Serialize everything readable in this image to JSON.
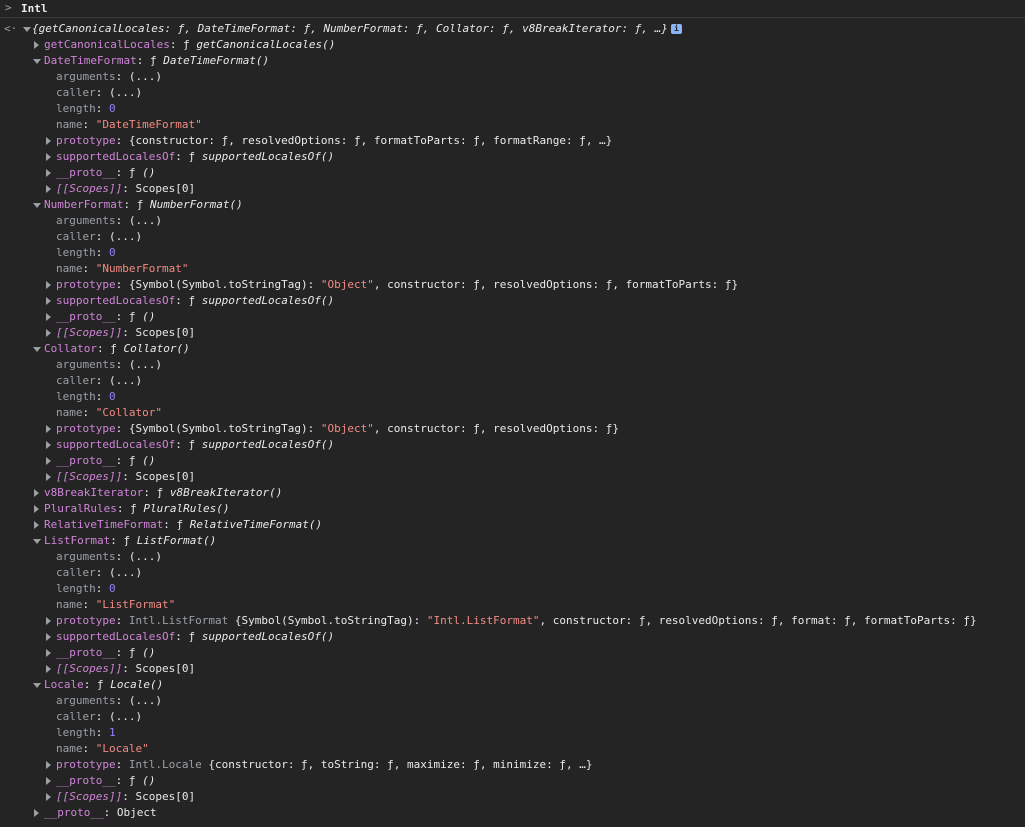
{
  "input": {
    "prompt_icon": "chevron-right-icon",
    "expression": "Intl"
  },
  "result": {
    "arrow_icon": "return-arrow-icon",
    "summary_keys": [
      "getCanonicalLocales",
      "DateTimeFormat",
      "NumberFormat",
      "Collator",
      "v8BreakIterator"
    ],
    "fn_symbol": "ƒ",
    "ellipsis": "…",
    "info_icon": "info-icon"
  },
  "rows": [
    {
      "indent": 1,
      "toggle": "collapsed",
      "key": "getCanonicalLocales",
      "kind": "fn",
      "fn_name": "getCanonicalLocales()"
    },
    {
      "indent": 1,
      "toggle": "expanded",
      "key": "DateTimeFormat",
      "kind": "fn",
      "fn_name": "DateTimeFormat()"
    },
    {
      "indent": 2,
      "toggle": "none",
      "key": "arguments",
      "kind": "plain",
      "text": "(...)"
    },
    {
      "indent": 2,
      "toggle": "none",
      "key": "caller",
      "kind": "plain",
      "text": "(...)"
    },
    {
      "indent": 2,
      "toggle": "none",
      "key": "length",
      "kind": "num",
      "text": "0"
    },
    {
      "indent": 2,
      "toggle": "none",
      "key": "name",
      "kind": "str",
      "text": "\"DateTimeFormat\""
    },
    {
      "indent": 2,
      "toggle": "collapsed",
      "key": "prototype",
      "kind": "obj",
      "text": "{constructor: ƒ, resolvedOptions: ƒ, formatToParts: ƒ, formatRange: ƒ, …}"
    },
    {
      "indent": 2,
      "toggle": "collapsed",
      "key": "supportedLocalesOf",
      "kind": "fn",
      "fn_name": "supportedLocalesOf()"
    },
    {
      "indent": 2,
      "toggle": "collapsed",
      "key": "__proto__",
      "kind": "fn",
      "fn_name": "()"
    },
    {
      "indent": 2,
      "toggle": "collapsed",
      "key": "[[Scopes]]",
      "kind": "scopes",
      "text": "Scopes[0]"
    },
    {
      "indent": 1,
      "toggle": "expanded",
      "key": "NumberFormat",
      "kind": "fn",
      "fn_name": "NumberFormat()"
    },
    {
      "indent": 2,
      "toggle": "none",
      "key": "arguments",
      "kind": "plain",
      "text": "(...)"
    },
    {
      "indent": 2,
      "toggle": "none",
      "key": "caller",
      "kind": "plain",
      "text": "(...)"
    },
    {
      "indent": 2,
      "toggle": "none",
      "key": "length",
      "kind": "num",
      "text": "0"
    },
    {
      "indent": 2,
      "toggle": "none",
      "key": "name",
      "kind": "str",
      "text": "\"NumberFormat\""
    },
    {
      "indent": 2,
      "toggle": "collapsed",
      "key": "prototype",
      "kind": "objstr",
      "pre": "{Symbol(Symbol.toStringTag): ",
      "strval": "\"Object\"",
      "post": ", constructor: ƒ, resolvedOptions: ƒ, formatToParts: ƒ}"
    },
    {
      "indent": 2,
      "toggle": "collapsed",
      "key": "supportedLocalesOf",
      "kind": "fn",
      "fn_name": "supportedLocalesOf()"
    },
    {
      "indent": 2,
      "toggle": "collapsed",
      "key": "__proto__",
      "kind": "fn",
      "fn_name": "()"
    },
    {
      "indent": 2,
      "toggle": "collapsed",
      "key": "[[Scopes]]",
      "kind": "scopes",
      "text": "Scopes[0]"
    },
    {
      "indent": 1,
      "toggle": "expanded",
      "key": "Collator",
      "kind": "fn",
      "fn_name": "Collator()"
    },
    {
      "indent": 2,
      "toggle": "none",
      "key": "arguments",
      "kind": "plain",
      "text": "(...)"
    },
    {
      "indent": 2,
      "toggle": "none",
      "key": "caller",
      "kind": "plain",
      "text": "(...)"
    },
    {
      "indent": 2,
      "toggle": "none",
      "key": "length",
      "kind": "num",
      "text": "0"
    },
    {
      "indent": 2,
      "toggle": "none",
      "key": "name",
      "kind": "str",
      "text": "\"Collator\""
    },
    {
      "indent": 2,
      "toggle": "collapsed",
      "key": "prototype",
      "kind": "objstr",
      "pre": "{Symbol(Symbol.toStringTag): ",
      "strval": "\"Object\"",
      "post": ", constructor: ƒ, resolvedOptions: ƒ}"
    },
    {
      "indent": 2,
      "toggle": "collapsed",
      "key": "supportedLocalesOf",
      "kind": "fn",
      "fn_name": "supportedLocalesOf()"
    },
    {
      "indent": 2,
      "toggle": "collapsed",
      "key": "__proto__",
      "kind": "fn",
      "fn_name": "()"
    },
    {
      "indent": 2,
      "toggle": "collapsed",
      "key": "[[Scopes]]",
      "kind": "scopes",
      "text": "Scopes[0]"
    },
    {
      "indent": 1,
      "toggle": "collapsed",
      "key": "v8BreakIterator",
      "kind": "fn",
      "fn_name": "v8BreakIterator()"
    },
    {
      "indent": 1,
      "toggle": "collapsed",
      "key": "PluralRules",
      "kind": "fn",
      "fn_name": "PluralRules()"
    },
    {
      "indent": 1,
      "toggle": "collapsed",
      "key": "RelativeTimeFormat",
      "kind": "fn",
      "fn_name": "RelativeTimeFormat()"
    },
    {
      "indent": 1,
      "toggle": "expanded",
      "key": "ListFormat",
      "kind": "fn",
      "fn_name": "ListFormat()"
    },
    {
      "indent": 2,
      "toggle": "none",
      "key": "arguments",
      "kind": "plain",
      "text": "(...)"
    },
    {
      "indent": 2,
      "toggle": "none",
      "key": "caller",
      "kind": "plain",
      "text": "(...)"
    },
    {
      "indent": 2,
      "toggle": "none",
      "key": "length",
      "kind": "num",
      "text": "0"
    },
    {
      "indent": 2,
      "toggle": "none",
      "key": "name",
      "kind": "str",
      "text": "\"ListFormat\""
    },
    {
      "indent": 2,
      "toggle": "collapsed",
      "key": "prototype",
      "kind": "clsobjstr",
      "cls": "Intl.ListFormat ",
      "pre": "{Symbol(Symbol.toStringTag): ",
      "strval": "\"Intl.ListFormat\"",
      "post": ", constructor: ƒ, resolvedOptions: ƒ, format: ƒ, formatToParts: ƒ}"
    },
    {
      "indent": 2,
      "toggle": "collapsed",
      "key": "supportedLocalesOf",
      "kind": "fn",
      "fn_name": "supportedLocalesOf()"
    },
    {
      "indent": 2,
      "toggle": "collapsed",
      "key": "__proto__",
      "kind": "fn",
      "fn_name": "()"
    },
    {
      "indent": 2,
      "toggle": "collapsed",
      "key": "[[Scopes]]",
      "kind": "scopes",
      "text": "Scopes[0]"
    },
    {
      "indent": 1,
      "toggle": "expanded",
      "key": "Locale",
      "kind": "fn",
      "fn_name": "Locale()"
    },
    {
      "indent": 2,
      "toggle": "none",
      "key": "arguments",
      "kind": "plain",
      "text": "(...)"
    },
    {
      "indent": 2,
      "toggle": "none",
      "key": "caller",
      "kind": "plain",
      "text": "(...)"
    },
    {
      "indent": 2,
      "toggle": "none",
      "key": "length",
      "kind": "num",
      "text": "1"
    },
    {
      "indent": 2,
      "toggle": "none",
      "key": "name",
      "kind": "str",
      "text": "\"Locale\""
    },
    {
      "indent": 2,
      "toggle": "collapsed",
      "key": "prototype",
      "kind": "clsobj",
      "cls": "Intl.Locale ",
      "text": "{constructor: ƒ, toString: ƒ, maximize: ƒ, minimize: ƒ, …}"
    },
    {
      "indent": 2,
      "toggle": "collapsed",
      "key": "__proto__",
      "kind": "fn",
      "fn_name": "()"
    },
    {
      "indent": 2,
      "toggle": "collapsed",
      "key": "[[Scopes]]",
      "kind": "scopes",
      "text": "Scopes[0]"
    },
    {
      "indent": 1,
      "toggle": "collapsed",
      "key": "__proto__",
      "kind": "plain",
      "text": "Object"
    }
  ]
}
